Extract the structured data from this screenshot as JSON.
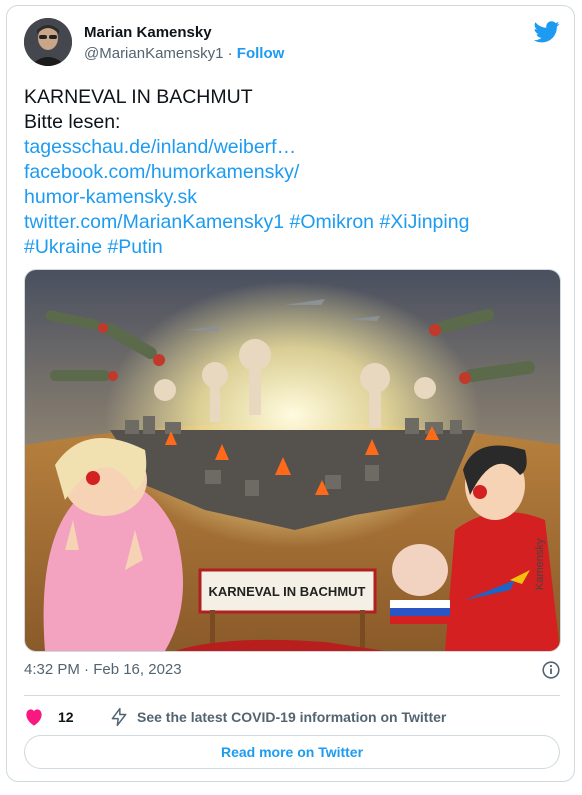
{
  "author": {
    "name": "Marian Kamensky",
    "handle": "@MarianKamensky1",
    "separator": " · ",
    "follow_label": "Follow"
  },
  "tweet": {
    "line1": "KARNEVAL IN BACHMUT",
    "line2": "Bitte lesen:",
    "link1": "tagesschau.de/inland/weiberf…",
    "link2": "facebook.com/humorkamensky/",
    "link3": "humor-kamensky.sk",
    "link4": "twitter.com/MarianKamensky1 #Omikron #XiJinping",
    "link5": "#Ukraine #Putin"
  },
  "media": {
    "sign_text": "KARNEVAL IN BACHMUT",
    "signature": "Kamensky"
  },
  "meta": {
    "timestamp": "4:32 PM · Feb 16, 2023"
  },
  "actions": {
    "like_count": "12",
    "covid_text": "See the latest COVID-19 information on Twitter",
    "read_more": "Read more on Twitter"
  },
  "colors": {
    "accent": "#1d9bf0",
    "like": "#f91880",
    "text": "#0f1419",
    "muted": "#536471",
    "border": "#cfd9de"
  }
}
